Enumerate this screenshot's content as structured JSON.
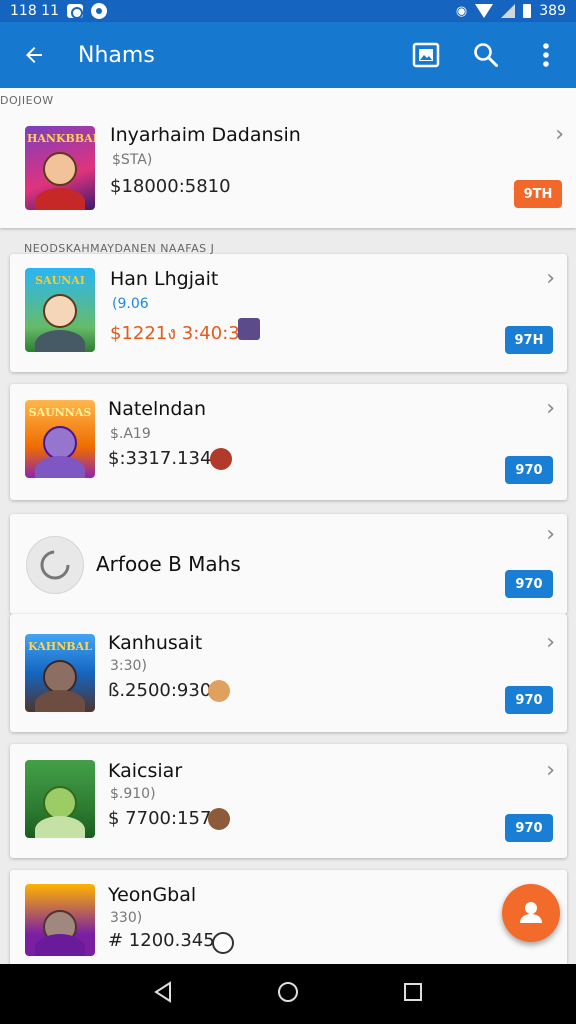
{
  "status_bar": {
    "time": "118 11",
    "battery": "389"
  },
  "app_bar": {
    "title": "Nhams"
  },
  "sections": [
    {
      "header": "DOJIEOW"
    },
    {
      "header": "NEODSKAHMAYDANEN NAAFAS J"
    }
  ],
  "items": [
    {
      "name": "Inyarhaim Dadansin",
      "sub": "$STA)",
      "price": "$18000:5810",
      "badge": "9TH",
      "thumb_banner": "HANKBBAR"
    },
    {
      "name": "Han Lhgjait",
      "sub": "(9.06",
      "price": "$1221ง 3:40:30",
      "badge": "97H",
      "thumb_banner": "SAUNAI"
    },
    {
      "name": "Natelndan",
      "sub": "$.A19",
      "price": "$:3317.134",
      "badge": "970",
      "thumb_banner": "SAUNNAS"
    },
    {
      "name": "Arfooe B Mahs",
      "sub": "",
      "price": "",
      "badge": "970"
    },
    {
      "name": "Kanhusait",
      "sub": "3:30)",
      "price": "ß.2500:930",
      "badge": "970",
      "thumb_banner": "KAHNBAL"
    },
    {
      "name": "Kaicsiar",
      "sub": "$.910)",
      "price": "$ 7700:157",
      "badge": "970",
      "thumb_banner": ""
    },
    {
      "name": "YeonGbal",
      "sub": "330)",
      "price": "# 1200.345",
      "badge": "",
      "thumb_banner": ""
    }
  ],
  "colors": {
    "primary": "#1778d0",
    "badge_blue": "#1a7fd4",
    "badge_orange": "#f2672a",
    "fab": "#f26b2a",
    "price_orange": "#e65a1a"
  },
  "icons": {
    "back": "arrow-left-icon",
    "image": "image-icon",
    "search": "search-icon",
    "more": "more-vert-icon",
    "chevron": "chevron-right-icon",
    "fab": "person-icon",
    "nav_back": "triangle-back-icon",
    "nav_home": "circle-home-icon",
    "nav_recent": "square-recent-icon"
  }
}
